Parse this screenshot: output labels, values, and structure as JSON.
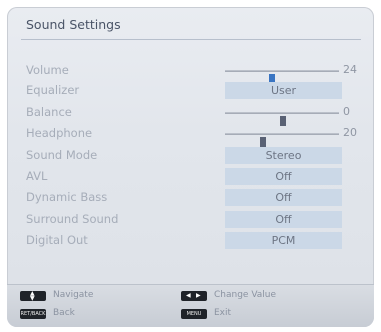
{
  "title": "Sound Settings",
  "settings": [
    {
      "label": "Volume",
      "type": "slider",
      "value": "24",
      "level": 0.41
    },
    {
      "label": "Equalizer",
      "type": "option",
      "value": "User"
    },
    {
      "label": "Balance",
      "type": "slider",
      "value": "0",
      "level": 0.51
    },
    {
      "label": "Headphone",
      "type": "slider",
      "value": "20",
      "level": 0.32
    },
    {
      "label": "Sound Mode",
      "type": "option",
      "value": "Stereo"
    },
    {
      "label": "AVL",
      "type": "option",
      "value": "Off"
    },
    {
      "label": "Dynamic Bass",
      "type": "option",
      "value": "Off"
    },
    {
      "label": "Surround Sound",
      "type": "option",
      "value": "Off"
    },
    {
      "label": "Digital Out",
      "type": "option",
      "value": "PCM"
    }
  ],
  "footer": {
    "navigate": "Navigate",
    "back_key": "RET/BACK",
    "back": "Back",
    "change_value": "Change Value",
    "menu_key": "MENU",
    "exit": "Exit"
  },
  "colors": {
    "panel_bg": "#e2e6ec",
    "value_box": "#cbd8e7",
    "selected_knob": "#3a75c2"
  }
}
